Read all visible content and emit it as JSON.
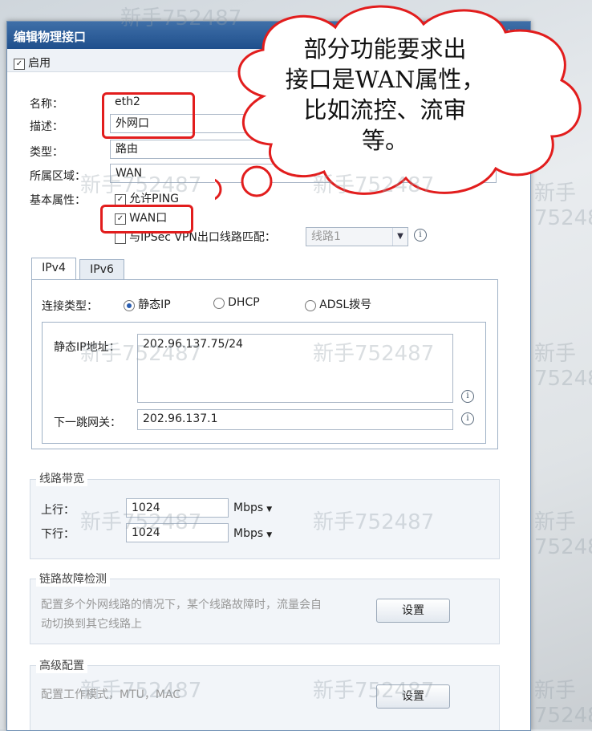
{
  "dialog": {
    "title": "编辑物理接口",
    "close": "×"
  },
  "toolbar": {
    "enable_label": "启用",
    "enable_checked": "✓"
  },
  "form": {
    "name_label": "名称：",
    "name_value": "eth2",
    "desc_label": "描述：",
    "desc_value": "外网口",
    "type_label": "类型：",
    "type_value": "路由",
    "zone_label": "所属区域：",
    "zone_value": "WAN",
    "attr_label": "基本属性：",
    "allow_ping_label": "允许PING",
    "wan_label": "WAN口",
    "ipsec_label": "与IPSec VPN出口线路匹配：",
    "ipsec_value": "线路1"
  },
  "tabs": [
    {
      "label": "IPv4"
    },
    {
      "label": "IPv6"
    }
  ],
  "ipv4": {
    "conn_type_label": "连接类型：",
    "options": [
      {
        "label": "静态IP"
      },
      {
        "label": "DHCP"
      },
      {
        "label": "ADSL拨号"
      }
    ],
    "static_ip_label": "静态IP地址：",
    "static_ip_value": "202.96.137.75/24",
    "gateway_label": "下一跳网关：",
    "gateway_value": "202.96.137.1"
  },
  "bandwidth": {
    "title": "线路带宽",
    "up_label": "上行：",
    "up_value": "1024",
    "up_unit": "Mbps",
    "down_label": "下行：",
    "down_value": "1024",
    "down_unit": "Mbps"
  },
  "failure": {
    "title": "链路故障检测",
    "desc_line1": "配置多个外网线路的情况下，某个线路故障时，流量会自",
    "desc_line2": "动切换到其它线路上",
    "button": "设置"
  },
  "advanced": {
    "title": "高级配置",
    "desc": "配置工作模式，MTU，MAC",
    "button": "设置"
  },
  "cloud": {
    "line1": "部分功能要求出",
    "line2": "接口是WAN属性，",
    "line3": "比如流控、流审",
    "line4": "等。"
  },
  "watermark": "新手752487",
  "icons": {
    "checkbox": "checkmark-icon",
    "select": "chevron-down-icon",
    "info": "info-icon",
    "caret": "caret-down-icon"
  }
}
